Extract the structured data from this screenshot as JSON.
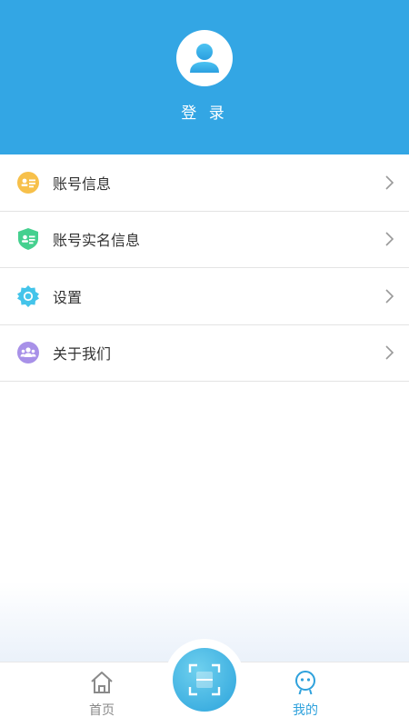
{
  "header": {
    "login_label": "登 录",
    "background_color": "#33a6e4",
    "avatar_icon": "user-avatar-icon"
  },
  "menu": {
    "items": [
      {
        "label": "账号信息",
        "icon": "id-card-icon",
        "icon_color": "#f6b93b"
      },
      {
        "label": "账号实名信息",
        "icon": "verified-shield-icon",
        "icon_color": "#3fcf8e"
      },
      {
        "label": "设置",
        "icon": "settings-gear-icon",
        "icon_color": "#3cbde8"
      },
      {
        "label": "关于我们",
        "icon": "group-users-icon",
        "icon_color": "#a28be6"
      }
    ]
  },
  "tabbar": {
    "home_label": "首页",
    "mine_label": "我的",
    "scan_icon": "scan-icon",
    "active_color": "#2ea1dc",
    "inactive_color": "#888888"
  }
}
